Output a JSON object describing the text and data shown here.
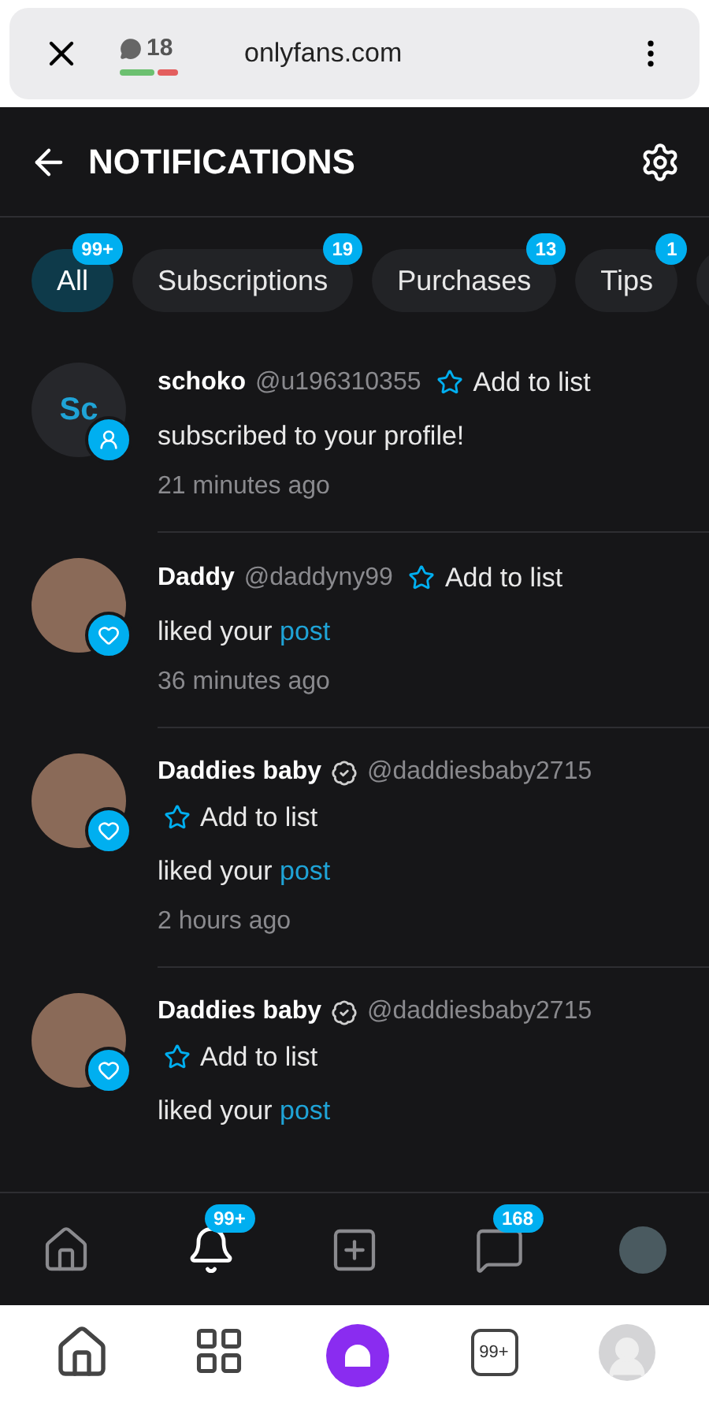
{
  "browser": {
    "tab_count": "18",
    "url": "onlyfans.com"
  },
  "header": {
    "title": "NOTIFICATIONS"
  },
  "tabs": [
    {
      "label": "All",
      "badge": "99+",
      "selected": true
    },
    {
      "label": "Subscriptions",
      "badge": "19",
      "selected": false
    },
    {
      "label": "Purchases",
      "badge": "13",
      "selected": false
    },
    {
      "label": "Tips",
      "badge": "1",
      "selected": false
    }
  ],
  "notifications": [
    {
      "kind": "subscribe",
      "avatar": {
        "kind": "initials",
        "text": "Sc"
      },
      "name": "schoko",
      "verified": false,
      "handle": "@u196310355",
      "action": "Add to list",
      "text": "subscribed to your profile!",
      "time": "21 minutes ago"
    },
    {
      "kind": "like",
      "avatar": {
        "kind": "photo"
      },
      "name": "Daddy",
      "verified": false,
      "handle": "@daddyny99",
      "action": "Add to list",
      "text": "liked your",
      "link": "post",
      "time": "36 minutes ago"
    },
    {
      "kind": "like",
      "avatar": {
        "kind": "photo"
      },
      "name": "Daddies baby",
      "verified": true,
      "handle": "@daddiesbaby2715",
      "action": "Add to list",
      "text": "liked your",
      "link": "post",
      "time": "2 hours ago"
    },
    {
      "kind": "like",
      "avatar": {
        "kind": "photo"
      },
      "name": "Daddies baby",
      "verified": true,
      "handle": "@daddiesbaby2715",
      "action": "Add to list",
      "text": "liked your",
      "link": "post"
    }
  ],
  "bottom_nav": [
    {
      "kind": "home",
      "selected": false
    },
    {
      "kind": "bell",
      "badge": "99+",
      "selected": true
    },
    {
      "kind": "add",
      "selected": false
    },
    {
      "kind": "messages",
      "badge": "168",
      "selected": false
    },
    {
      "kind": "avatar",
      "selected": false
    }
  ],
  "browser_nav": {
    "tabs_label": "99+"
  }
}
